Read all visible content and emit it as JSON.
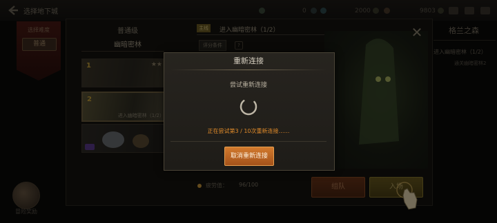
{
  "topbar": {
    "title": "选择地下城",
    "currency1": "0",
    "currency2": "2000",
    "currency3": "9803"
  },
  "left": {
    "banner_label": "选择难度",
    "difficulty": "普通",
    "reward_label": "冒险奖励"
  },
  "main": {
    "difficulty_level": "普通级",
    "dungeon_name": "幽暗密林",
    "card1": {
      "num": "1",
      "stars": "★★"
    },
    "card2": {
      "num": "2",
      "caption": "进入幽暗密林（1/2）"
    },
    "quest_tag": "主线",
    "quest_title": "进入幽暗密林（1/2）",
    "score_tab": "评分条件",
    "score_help": "?",
    "close_symbol": "✕",
    "fatigue_label": "疲劳值：",
    "fatigue_value": "96/100",
    "team_button": "组队",
    "enter_button": "入场"
  },
  "right": {
    "region_name": "格兰之森",
    "sub1": "进入幽暗密林（1/2）",
    "sub2": "通关幽暗密林2"
  },
  "dialog": {
    "title": "重新连接",
    "message": "尝试重新连接",
    "status": "正在尝试第3 / 10次重新连接……",
    "cancel_button": "取消重新连接"
  },
  "colors": {
    "accent_orange": "#d27a2e",
    "status_orange": "#e08a2a",
    "gold": "#c8a23a"
  },
  "icons": [
    "back-arrow-icon",
    "coin-icon",
    "gem-icon",
    "spinner-icon",
    "close-icon",
    "hand-pointer-icon"
  ]
}
